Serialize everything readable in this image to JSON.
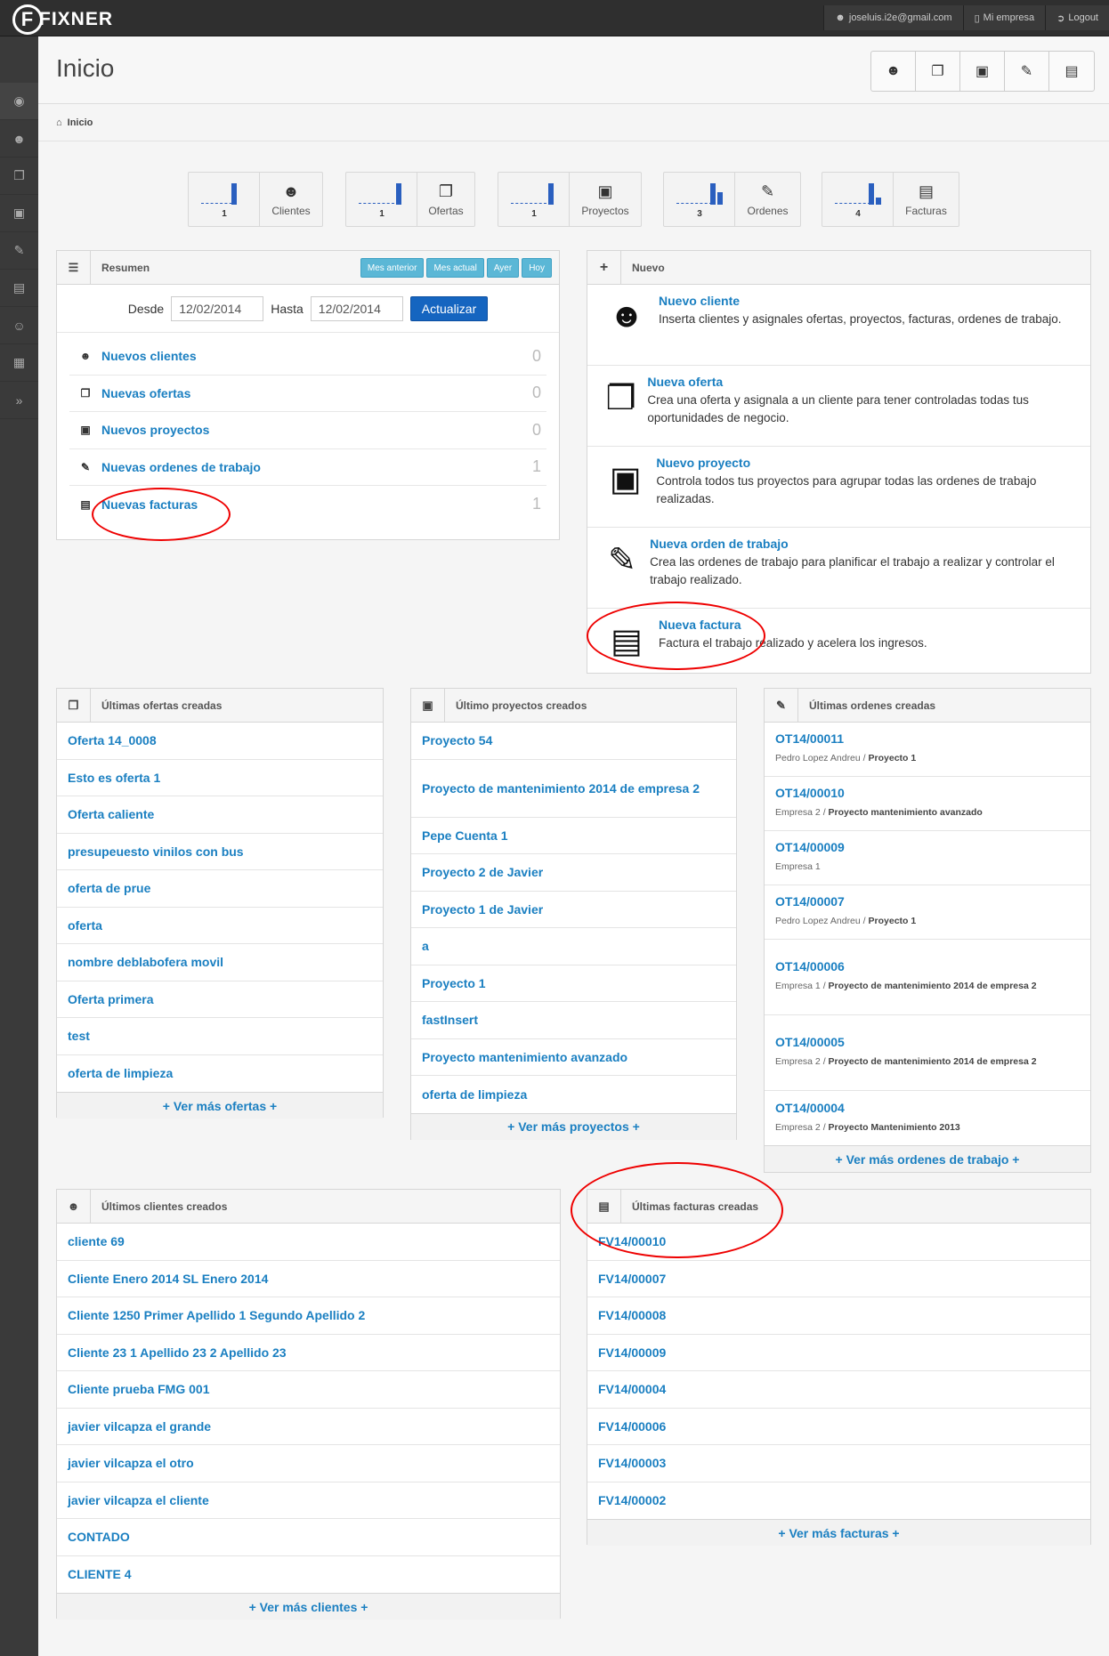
{
  "app": {
    "logo": "FIXNER",
    "logo_letter": "F"
  },
  "topnav": {
    "email": "joseluis.i2e@gmail.com",
    "empresa": "Mi empresa",
    "logout": "Logout"
  },
  "page": {
    "title": "Inicio",
    "breadcrumb": "Inicio"
  },
  "stats": [
    {
      "count": "1",
      "label": "Clientes",
      "icon": "users-icon"
    },
    {
      "count": "1",
      "label": "Ofertas",
      "icon": "offers-icon"
    },
    {
      "count": "1",
      "label": "Proyectos",
      "icon": "briefcase-icon"
    },
    {
      "count": "3",
      "label": "Ordenes",
      "icon": "work-order-icon"
    },
    {
      "count": "4",
      "label": "Facturas",
      "icon": "invoice-icon"
    }
  ],
  "resumen": {
    "title": "Resumen",
    "buttons": [
      "Mes anterior",
      "Mes actual",
      "Ayer",
      "Hoy"
    ],
    "desde_label": "Desde",
    "desde_value": "12/02/2014",
    "hasta_label": "Hasta",
    "hasta_value": "12/02/2014",
    "update_label": "Actualizar",
    "rows": [
      {
        "label": "Nuevos clientes",
        "count": "0"
      },
      {
        "label": "Nuevas ofertas",
        "count": "0"
      },
      {
        "label": "Nuevos proyectos",
        "count": "0"
      },
      {
        "label": "Nuevas ordenes de trabajo",
        "count": "1"
      },
      {
        "label": "Nuevas facturas",
        "count": "1"
      }
    ]
  },
  "nuevo": {
    "title": "Nuevo",
    "items": [
      {
        "title": "Nuevo cliente",
        "desc": "Inserta clientes y asignales ofertas, proyectos, facturas, ordenes de trabajo."
      },
      {
        "title": "Nueva oferta",
        "desc": "Crea una oferta y asignala a un cliente para tener controladas todas tus oportunidades de negocio."
      },
      {
        "title": "Nuevo proyecto",
        "desc": "Controla todos tus proyectos para agrupar todas las ordenes de trabajo realizadas."
      },
      {
        "title": "Nueva orden de trabajo",
        "desc": "Crea las ordenes de trabajo para planificar el trabajo a realizar y controlar el trabajo realizado."
      },
      {
        "title": "Nueva factura",
        "desc": "Factura el trabajo realizado y acelera los ingresos."
      }
    ]
  },
  "ofertas": {
    "title": "Últimas ofertas creadas",
    "items": [
      "Oferta 14_0008",
      "Esto es oferta 1",
      "Oferta caliente",
      "presupeuesto vinilos con bus",
      "oferta de prue",
      "oferta",
      "nombre deblabofera movil",
      "Oferta primera",
      "test",
      "oferta de limpieza"
    ],
    "more": "+ Ver más ofertas +"
  },
  "proyectos": {
    "title": "Último proyectos creados",
    "items": [
      "Proyecto 54",
      "Proyecto de mantenimiento 2014 de empresa 2",
      "Pepe Cuenta 1",
      "Proyecto 2 de Javier",
      "Proyecto 1 de Javier",
      "a",
      "Proyecto 1",
      "fastInsert",
      "Proyecto mantenimiento avanzado",
      "oferta de limpieza"
    ],
    "more": "+ Ver más proyectos +"
  },
  "ordenes": {
    "title": "Últimas ordenes creadas",
    "items": [
      {
        "code": "OT14/00011",
        "client": "Pedro Lopez Andreu",
        "project": "Proyecto 1"
      },
      {
        "code": "OT14/00010",
        "client": "Empresa 2",
        "project": "Proyecto mantenimiento avanzado"
      },
      {
        "code": "OT14/00009",
        "client": "Empresa 1",
        "project": ""
      },
      {
        "code": "OT14/00007",
        "client": "Pedro Lopez Andreu",
        "project": "Proyecto 1"
      },
      {
        "code": "OT14/00006",
        "client": "Empresa 1",
        "project": "Proyecto de mantenimiento 2014 de empresa 2"
      },
      {
        "code": "OT14/00005",
        "client": "Empresa 2",
        "project": "Proyecto de mantenimiento 2014 de empresa 2"
      },
      {
        "code": "OT14/00004",
        "client": "Empresa 2",
        "project": "Proyecto Mantenimiento 2013"
      }
    ],
    "more": "+ Ver más ordenes de trabajo +"
  },
  "clientes": {
    "title": "Últimos clientes creados",
    "items": [
      "cliente 69",
      "Cliente Enero 2014 SL Enero 2014",
      "Cliente 1250 Primer Apellido 1 Segundo Apellido 2",
      "Cliente 23 1 Apellido 23 2 Apellido 23",
      "Cliente prueba FMG 001",
      "javier vilcapza el grande",
      "javier vilcapza el otro",
      "javier vilcapza el cliente",
      "CONTADO",
      "CLIENTE 4"
    ],
    "more": "+ Ver más clientes +"
  },
  "facturas": {
    "title": "Últimas facturas creadas",
    "items": [
      "FV14/00010",
      "FV14/00007",
      "FV14/00008",
      "FV14/00009",
      "FV14/00004",
      "FV14/00006",
      "FV14/00003",
      "FV14/00002"
    ],
    "more": "+ Ver más facturas +"
  },
  "colors": {
    "link": "#1a7fc1",
    "accent_button": "#5bb7d6",
    "primary_button": "#1565c0",
    "annotation": "#e00000"
  }
}
